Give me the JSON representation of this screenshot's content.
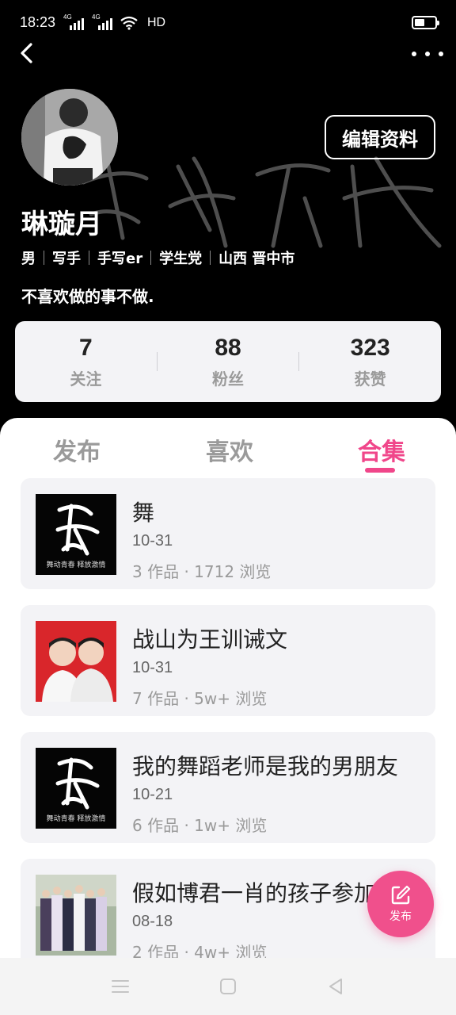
{
  "status_bar": {
    "time": "18:23",
    "net1": "4G",
    "net2": "4G",
    "hd": "HD"
  },
  "profile": {
    "edit_label": "编辑资料",
    "username": "琳璇月",
    "tags": [
      "男",
      "写手",
      "手写er",
      "学生党",
      "山西 晋中市"
    ],
    "bio": "不喜欢做的事不做."
  },
  "stats": [
    {
      "value": "7",
      "label": "关注"
    },
    {
      "value": "88",
      "label": "粉丝"
    },
    {
      "value": "323",
      "label": "获赞"
    }
  ],
  "tabs": [
    "发布",
    "喜欢",
    "合集"
  ],
  "active_tab": "合集",
  "collections": [
    {
      "title": "舞",
      "date": "10-31",
      "meta": "3 作品 · 1712 浏览",
      "thumb": "dance-logo"
    },
    {
      "title": "战山为王训诫文",
      "date": "10-31",
      "meta": "7 作品 · 5w+ 浏览",
      "thumb": "two-people-red"
    },
    {
      "title": "我的舞蹈老师是我的男朋友",
      "date": "10-21",
      "meta": "6 作品 · 1w+ 浏览",
      "thumb": "dance-logo"
    },
    {
      "title": "假如博君一肖的孩子参加",
      "date": "08-18",
      "meta": "2 作品 · 4w+ 浏览",
      "thumb": "group-costume"
    }
  ],
  "fab": {
    "label": "发布"
  },
  "colors": {
    "accent": "#f0468a",
    "card_bg": "#f3f3f6",
    "header_bg": "#000000"
  }
}
